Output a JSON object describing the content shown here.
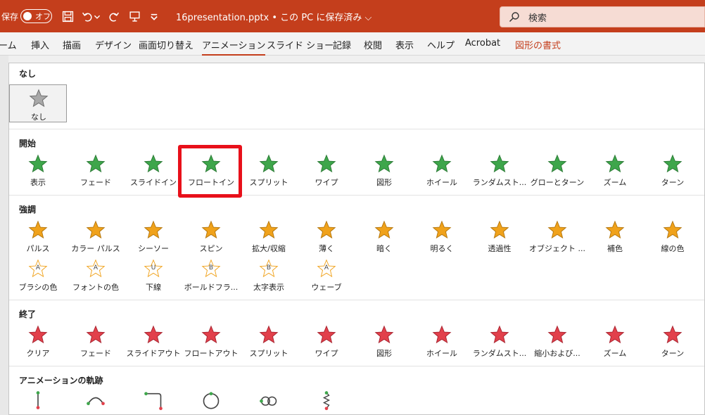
{
  "titlebar": {
    "autosave_label": "保存",
    "toggle_text": "オフ",
    "filename": "16presentation.pptx • この PC に保存済み ⌵",
    "search_placeholder": "検索"
  },
  "colors": {
    "accent": "#c43e1c",
    "entrance": "#3ea64b",
    "emphasis": "#f0a21b",
    "exit": "#e2404b",
    "highlight": "#e8101a"
  },
  "tabs": [
    "ーム",
    "挿入",
    "描画",
    "デザイン",
    "画面切り替え",
    "アニメーション",
    "スライド ショー",
    "記録",
    "校閲",
    "表示",
    "ヘルプ",
    "Acrobat",
    "図形の書式"
  ],
  "sections": {
    "none": {
      "title": "なし",
      "item": "なし"
    },
    "entrance": {
      "title": "開始",
      "items": [
        "表示",
        "フェード",
        "スライドイン",
        "フロートイン",
        "スプリット",
        "ワイプ",
        "図形",
        "ホイール",
        "ランダムスト...",
        "グローとターン",
        "ズーム",
        "ターン"
      ]
    },
    "emphasis": {
      "title": "強調",
      "row1": [
        "パルス",
        "カラー パルス",
        "シーソー",
        "スピン",
        "拡大/収縮",
        "薄く",
        "暗く",
        "明るく",
        "透過性",
        "オブジェクト ...",
        "補色",
        "線の色"
      ],
      "row2": [
        "ブラシの色",
        "フォントの色",
        "下線",
        "ボールドフラ...",
        "太字表示",
        "ウェーブ"
      ],
      "row2_letters": [
        "A",
        "A",
        "U",
        "B",
        "B",
        "A"
      ]
    },
    "exit": {
      "title": "終了",
      "items": [
        "クリア",
        "フェード",
        "スライドアウト",
        "フロートアウト",
        "スプリット",
        "ワイプ",
        "図形",
        "ホイール",
        "ランダムスト...",
        "縮小および...",
        "ズーム",
        "ターン"
      ]
    },
    "paths": {
      "title": "アニメーションの軌跡"
    }
  }
}
